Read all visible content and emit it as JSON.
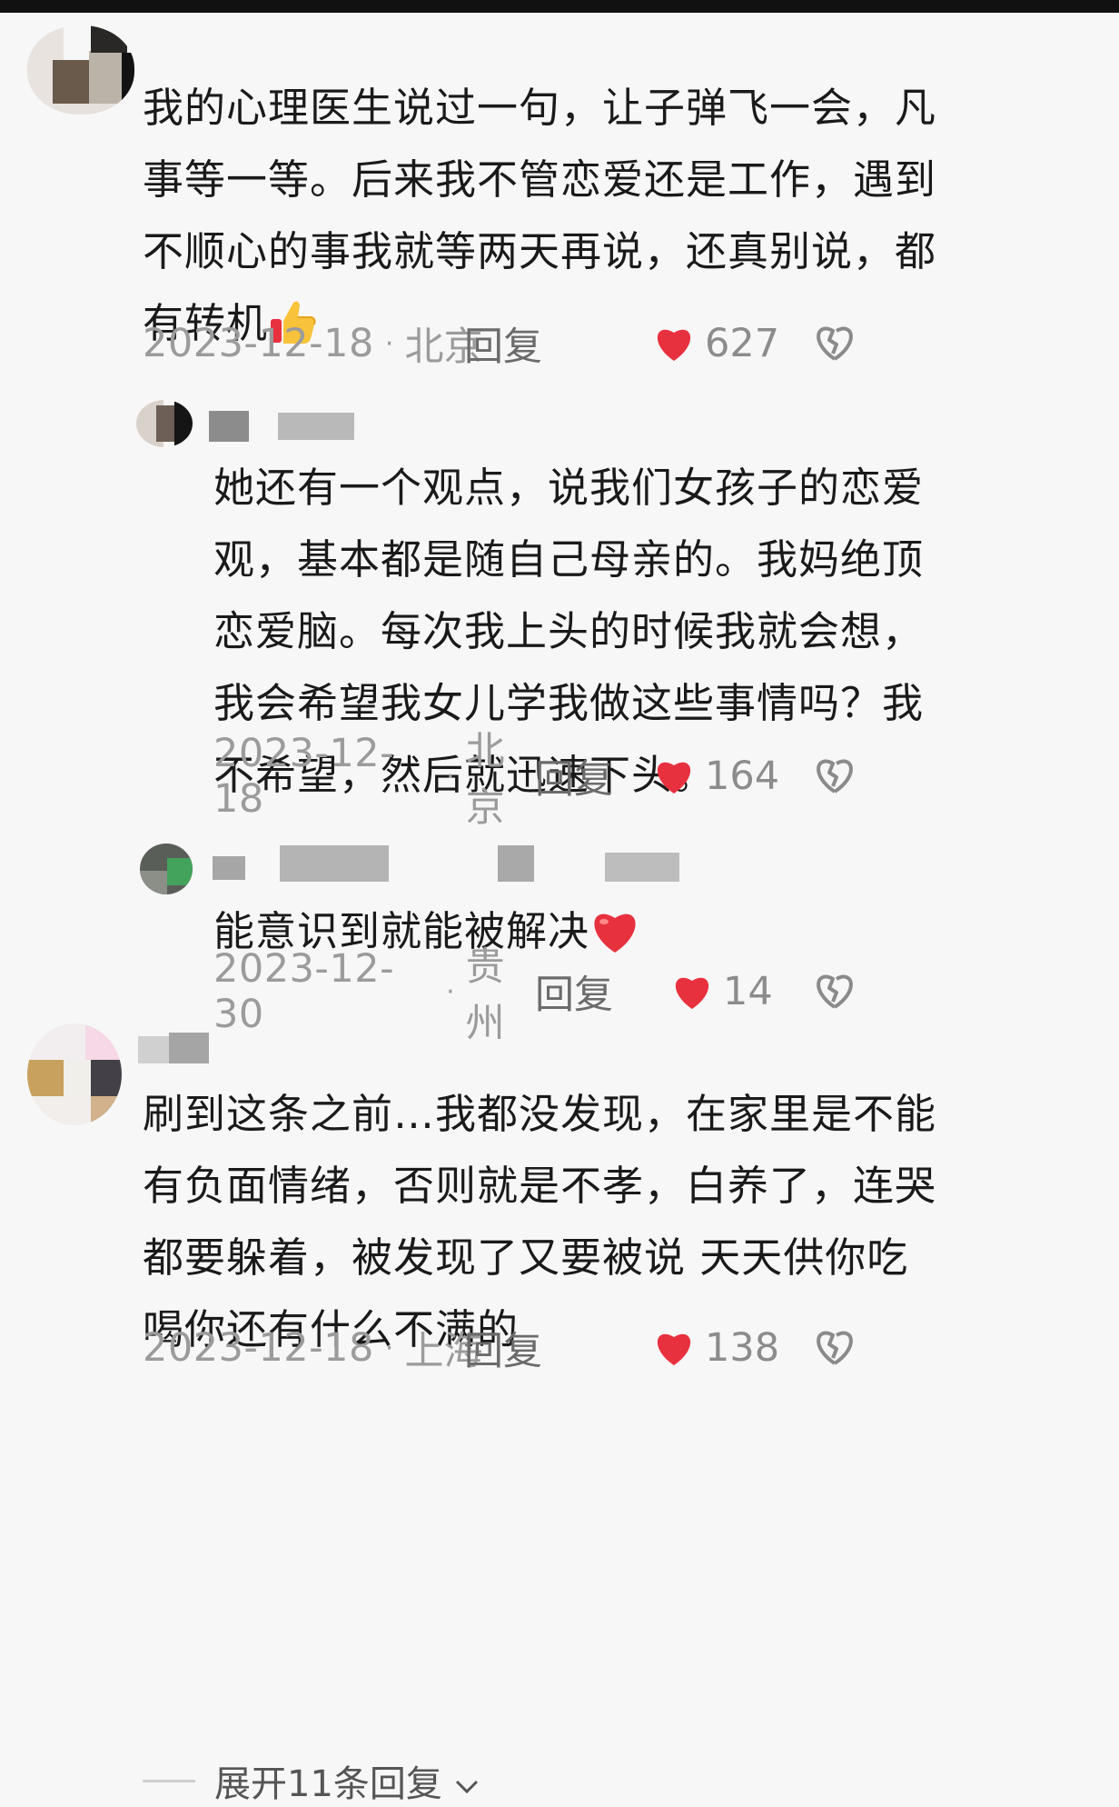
{
  "colors": {
    "background": "#f7f7f7",
    "like_heart": "#e8313f",
    "meta_text": "#9b9b9b",
    "reply_text": "#6b6b6b"
  },
  "comments": [
    {
      "lines": [
        "我的心理医生说过一句，让子弹飞一会，凡",
        "事等一等。后来我不管恋爱还是工作，遇到",
        "不顺心的事我就等两天再说，还真别说，都",
        "有转机"
      ],
      "emoji": "thumbs-up-icon",
      "date": "2023-12-18",
      "location": "北京",
      "reply_label": "回复",
      "likes": "627"
    },
    {
      "lines": [
        "她还有一个观点，说我们女孩子的恋爱",
        "观，基本都是随自己母亲的。我妈绝顶",
        "恋爱脑。每次我上头的时候我就会想，",
        "我会希望我女儿学我做这些事情吗？我",
        "不希望，然后就迅速下头。"
      ],
      "date": "2023-12-18",
      "location": "北京",
      "reply_label": "回复",
      "likes": "164"
    },
    {
      "lines": [
        "能意识到就能被解决"
      ],
      "emoji": "red-heart-icon",
      "date": "2023-12-30",
      "location": "贵州",
      "reply_label": "回复",
      "likes": "14"
    },
    {
      "lines": [
        "刷到这条之前…我都没发现，在家里是不能",
        "有负面情绪，否则就是不孝，白养了，连哭",
        "都要躲着，被发现了又要被说 天天供你吃",
        "喝你还有什么不满的"
      ],
      "date": "2023-12-18",
      "location": "上海",
      "reply_label": "回复",
      "likes": "138"
    }
  ],
  "expand_label": "展开11条回复",
  "expand_icon": "chevron-down-icon"
}
